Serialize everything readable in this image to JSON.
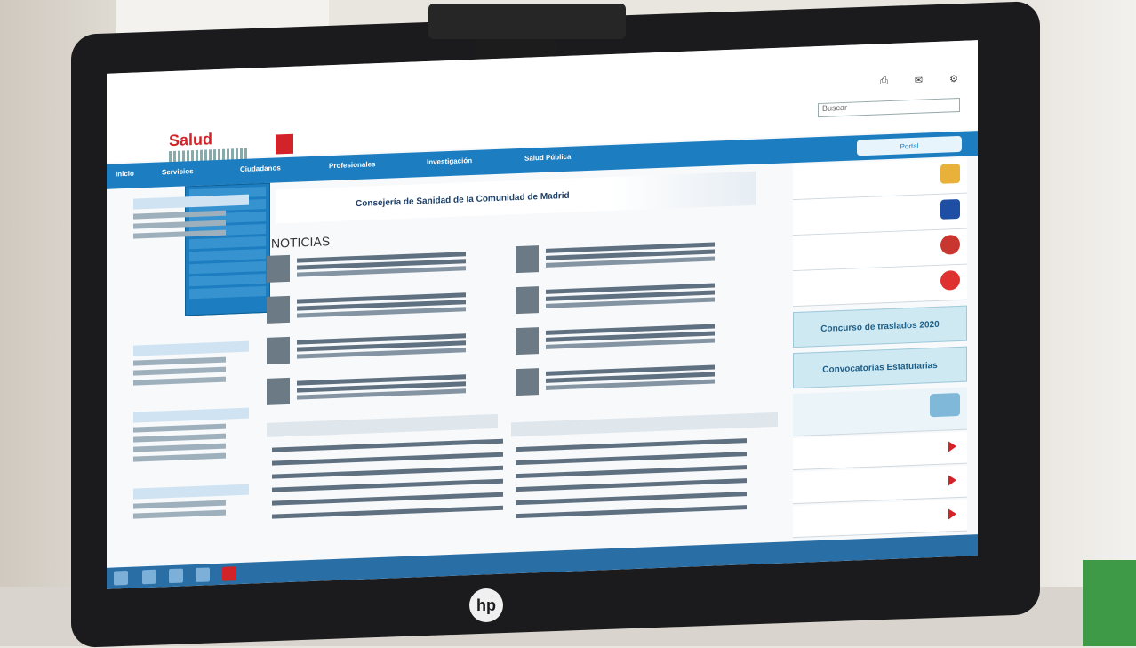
{
  "header": {
    "brand": "Salud",
    "icons": [
      "print-icon",
      "share-icon",
      "settings-icon"
    ],
    "search_placeholder": "Buscar"
  },
  "nav": {
    "items": [
      "Inicio",
      "Servicios",
      "Ciudadanos",
      "Profesionales",
      "Investigación",
      "Salud Pública"
    ],
    "right_button": "Portal"
  },
  "banner": {
    "title": "Consejería de Sanidad de la Comunidad de Madrid"
  },
  "news": {
    "heading": "NOTICIAS"
  },
  "right": {
    "buttons": [
      "Concurso de traslados 2020",
      "Convocatorias Estatutarias"
    ],
    "links": [
      "",
      "",
      ""
    ]
  },
  "colors": {
    "accent": "#1c7ec1",
    "brand_red": "#d22329"
  }
}
